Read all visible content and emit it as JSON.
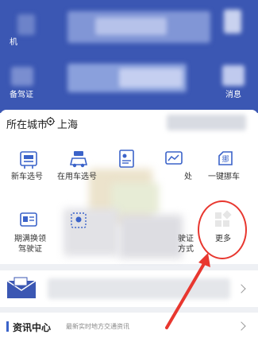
{
  "header": {
    "left_top_label": "机",
    "left_bottom_label": "备驾证",
    "right_bottom_label": "消息"
  },
  "city": {
    "label": "所在城市",
    "name": "上海"
  },
  "services": [
    {
      "label": "新车选号",
      "icon": "new-car-plate-icon"
    },
    {
      "label": "在用车选号",
      "icon": "used-car-plate-icon"
    },
    {
      "label": "",
      "icon": "document-id-icon"
    },
    {
      "label": "处",
      "icon": "violation-handling-icon"
    },
    {
      "label": "一键挪车",
      "icon": "move-car-icon"
    },
    {
      "label": "期满换领驾驶证",
      "icon": "license-renewal-icon"
    },
    {
      "label": "",
      "icon": "pin-square-icon"
    },
    {
      "label": "驶证方式",
      "icon": "license-method-icon"
    },
    {
      "label": "更多",
      "icon": "more-grid-icon"
    }
  ],
  "news": {
    "title": "资讯中心",
    "subtitle": "最新实时地方交通资讯"
  },
  "colors": {
    "header_blue": "#3b57b3",
    "accent_blue": "#3b63c9",
    "annotation_red": "#e8372f"
  }
}
